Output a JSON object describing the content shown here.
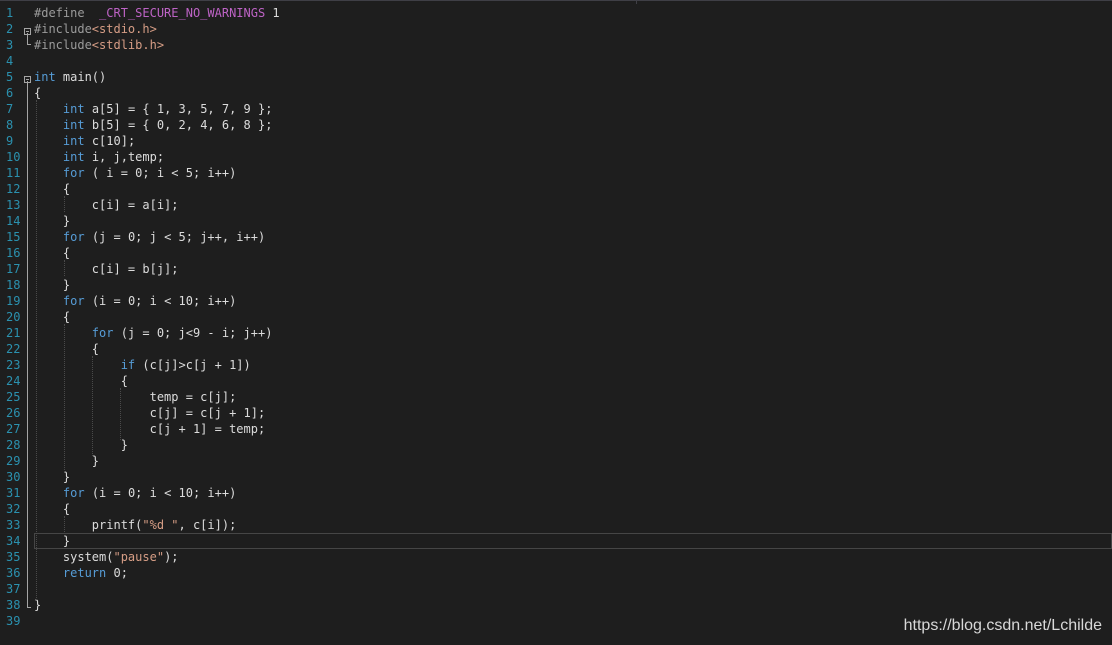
{
  "editor": {
    "language": "c",
    "current_line": 34,
    "colors": {
      "background": "#1e1e1e",
      "line_number": "#2b91af",
      "keyword": "#569cd6",
      "macro": "#bd63c5",
      "string": "#d69d85",
      "text": "#dcdcdc"
    },
    "lines": [
      {
        "n": "1",
        "parts": [
          [
            "pp",
            "#define"
          ],
          [
            "",
            "  "
          ],
          [
            "mac",
            "_CRT_SECURE_NO_WARNINGS"
          ],
          [
            "",
            " 1"
          ]
        ]
      },
      {
        "n": "2",
        "parts": [
          [
            "pp",
            "#include"
          ],
          [
            "inc",
            "<stdio.h>"
          ]
        ]
      },
      {
        "n": "3",
        "parts": [
          [
            "pp",
            "#include"
          ],
          [
            "inc",
            "<stdlib.h>"
          ]
        ]
      },
      {
        "n": "4",
        "parts": []
      },
      {
        "n": "5",
        "parts": [
          [
            "kw",
            "int"
          ],
          [
            "",
            " main()"
          ]
        ]
      },
      {
        "n": "6",
        "parts": [
          [
            "",
            "{"
          ]
        ]
      },
      {
        "n": "7",
        "parts": [
          [
            "",
            "    "
          ],
          [
            "kw",
            "int"
          ],
          [
            "",
            " a[5] = { 1, 3, 5, 7, 9 };"
          ]
        ]
      },
      {
        "n": "8",
        "parts": [
          [
            "",
            "    "
          ],
          [
            "kw",
            "int"
          ],
          [
            "",
            " b[5] = { 0, 2, 4, 6, 8 };"
          ]
        ]
      },
      {
        "n": "9",
        "parts": [
          [
            "",
            "    "
          ],
          [
            "kw",
            "int"
          ],
          [
            "",
            " c[10];"
          ]
        ]
      },
      {
        "n": "10",
        "parts": [
          [
            "",
            "    "
          ],
          [
            "kw",
            "int"
          ],
          [
            "",
            " i, j,temp;"
          ]
        ]
      },
      {
        "n": "11",
        "parts": [
          [
            "",
            "    "
          ],
          [
            "kw",
            "for"
          ],
          [
            "",
            " ( i = 0; i < 5; i++)"
          ]
        ]
      },
      {
        "n": "12",
        "parts": [
          [
            "",
            "    {"
          ]
        ]
      },
      {
        "n": "13",
        "parts": [
          [
            "",
            "        c[i] = a[i];"
          ]
        ]
      },
      {
        "n": "14",
        "parts": [
          [
            "",
            "    }"
          ]
        ]
      },
      {
        "n": "15",
        "parts": [
          [
            "",
            "    "
          ],
          [
            "kw",
            "for"
          ],
          [
            "",
            " (j = 0; j < 5; j++, i++)"
          ]
        ]
      },
      {
        "n": "16",
        "parts": [
          [
            "",
            "    {"
          ]
        ]
      },
      {
        "n": "17",
        "parts": [
          [
            "",
            "        c[i] = b[j];"
          ]
        ]
      },
      {
        "n": "18",
        "parts": [
          [
            "",
            "    }"
          ]
        ]
      },
      {
        "n": "19",
        "parts": [
          [
            "",
            "    "
          ],
          [
            "kw",
            "for"
          ],
          [
            "",
            " (i = 0; i < 10; i++)"
          ]
        ]
      },
      {
        "n": "20",
        "parts": [
          [
            "",
            "    {"
          ]
        ]
      },
      {
        "n": "21",
        "parts": [
          [
            "",
            "        "
          ],
          [
            "kw",
            "for"
          ],
          [
            "",
            " (j = 0; j<9 - i; j++)"
          ]
        ]
      },
      {
        "n": "22",
        "parts": [
          [
            "",
            "        {"
          ]
        ]
      },
      {
        "n": "23",
        "parts": [
          [
            "",
            "            "
          ],
          [
            "kw",
            "if"
          ],
          [
            "",
            " (c[j]>c[j + 1])"
          ]
        ]
      },
      {
        "n": "24",
        "parts": [
          [
            "",
            "            {"
          ]
        ]
      },
      {
        "n": "25",
        "parts": [
          [
            "",
            "                temp = c[j];"
          ]
        ]
      },
      {
        "n": "26",
        "parts": [
          [
            "",
            "                c[j] = c[j + 1];"
          ]
        ]
      },
      {
        "n": "27",
        "parts": [
          [
            "",
            "                c[j + 1] = temp;"
          ]
        ]
      },
      {
        "n": "28",
        "parts": [
          [
            "",
            "            }"
          ]
        ]
      },
      {
        "n": "29",
        "parts": [
          [
            "",
            "        }"
          ]
        ]
      },
      {
        "n": "30",
        "parts": [
          [
            "",
            "    }"
          ]
        ]
      },
      {
        "n": "31",
        "parts": [
          [
            "",
            "    "
          ],
          [
            "kw",
            "for"
          ],
          [
            "",
            " (i = 0; i < 10; i++)"
          ]
        ]
      },
      {
        "n": "32",
        "parts": [
          [
            "",
            "    {"
          ]
        ]
      },
      {
        "n": "33",
        "parts": [
          [
            "",
            "        printf("
          ],
          [
            "str",
            "\"%d \""
          ],
          [
            "",
            ", c[i]);"
          ]
        ]
      },
      {
        "n": "34",
        "parts": [
          [
            "",
            "    }"
          ]
        ]
      },
      {
        "n": "35",
        "parts": [
          [
            "",
            "    system("
          ],
          [
            "str",
            "\"pause\""
          ],
          [
            "",
            ");"
          ]
        ]
      },
      {
        "n": "36",
        "parts": [
          [
            "",
            "    "
          ],
          [
            "kw",
            "return"
          ],
          [
            "",
            " 0;"
          ]
        ]
      },
      {
        "n": "37",
        "parts": []
      },
      {
        "n": "38",
        "parts": [
          [
            "",
            "}"
          ]
        ]
      },
      {
        "n": "39",
        "parts": []
      }
    ]
  },
  "watermark": "https://blog.csdn.net/Lchilde"
}
